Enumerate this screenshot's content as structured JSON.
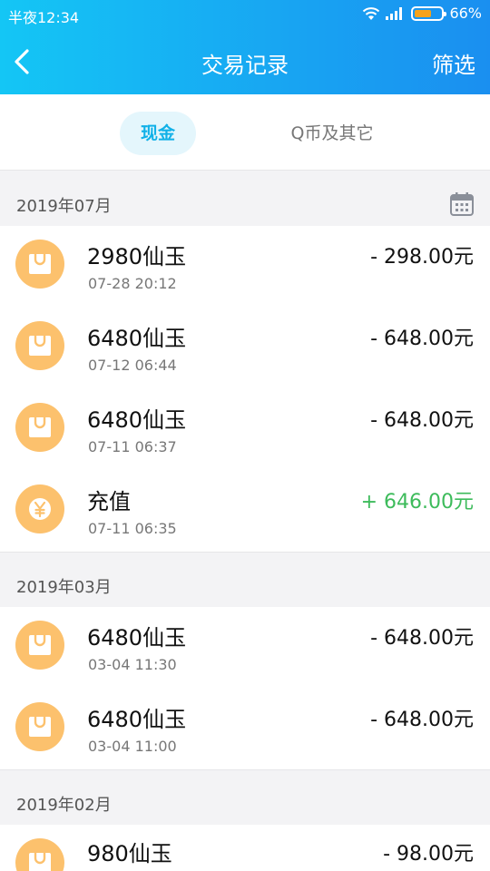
{
  "status_bar": {
    "time": "半夜12:34",
    "battery": "66%",
    "battery_level": 0.66
  },
  "nav": {
    "title": "交易记录",
    "filter_label": "筛选"
  },
  "tabs": [
    {
      "label": "现金",
      "active": true
    },
    {
      "label": "Q币及其它",
      "active": false
    }
  ],
  "sections": [
    {
      "title": "2019年07月",
      "items": [
        {
          "title": "2980仙玉",
          "date": "07-28 20:12",
          "amount": "- 298.00元",
          "type": "purchase"
        },
        {
          "title": "6480仙玉",
          "date": "07-12 06:44",
          "amount": "- 648.00元",
          "type": "purchase"
        },
        {
          "title": "6480仙玉",
          "date": "07-11 06:37",
          "amount": "- 648.00元",
          "type": "purchase"
        },
        {
          "title": "充值",
          "date": "07-11 06:35",
          "amount": "+ 646.00元",
          "type": "recharge"
        }
      ]
    },
    {
      "title": "2019年03月",
      "items": [
        {
          "title": "6480仙玉",
          "date": "03-04 11:30",
          "amount": "- 648.00元",
          "type": "purchase"
        },
        {
          "title": "6480仙玉",
          "date": "03-04 11:00",
          "amount": "- 648.00元",
          "type": "purchase"
        }
      ]
    },
    {
      "title": "2019年02月",
      "items": [
        {
          "title": "980仙玉",
          "date": "",
          "amount": "- 98.00元",
          "type": "purchase"
        }
      ]
    }
  ],
  "colors": {
    "header": "#18a4f2",
    "accent": "#11b1e8",
    "icon_bg": "#fcc16d",
    "positive": "#3dbb5b"
  }
}
